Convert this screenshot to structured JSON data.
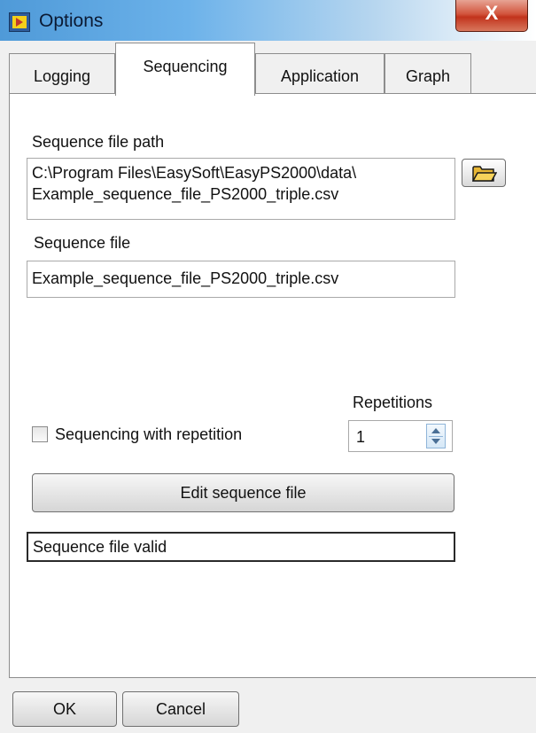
{
  "window": {
    "title": "Options",
    "close_label": "X",
    "icon": "app-icon"
  },
  "tabs": [
    {
      "label": "Logging",
      "active": false
    },
    {
      "label": "Sequencing",
      "active": true
    },
    {
      "label": "Application",
      "active": false
    },
    {
      "label": "Graph",
      "active": false
    }
  ],
  "sequencing": {
    "file_path_label": "Sequence file path",
    "file_path_line1": "C:\\Program Files\\EasySoft\\EasyPS2000\\data\\",
    "file_path_line2": "Example_sequence_file_PS2000_triple.csv",
    "browse_icon": "folder-open-icon",
    "file_label": "Sequence file",
    "file_value": "Example_sequence_file_PS2000_triple.csv",
    "repetition_checkbox_label": "Sequencing with repetition",
    "repetition_checked": false,
    "repetitions_label": "Repetitions",
    "repetitions_value": "1",
    "edit_button_label": "Edit sequence file",
    "status_text": "Sequence file valid"
  },
  "footer": {
    "ok_label": "OK",
    "cancel_label": "Cancel"
  }
}
